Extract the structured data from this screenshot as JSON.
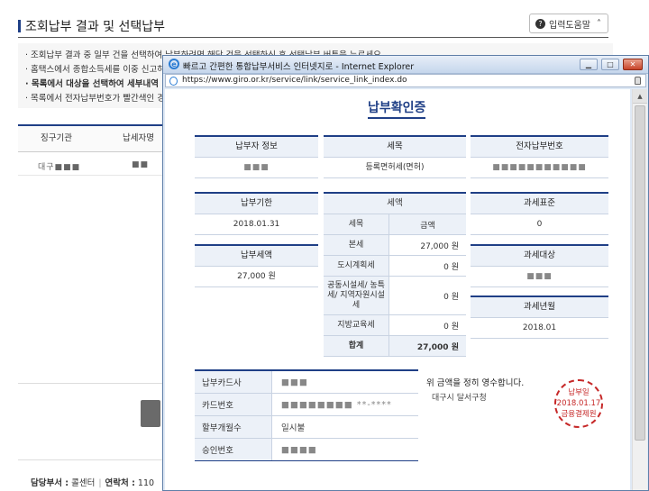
{
  "background": {
    "title": "조회납부 결과 및 선택납부",
    "help_button": "입력도움말",
    "notes": [
      "· 조회납부 결과 중 일부 건을 선택하여 납부하려면 해당 건을 선택하신 후 선택납부 버튼을 누르세요.",
      "· 홈택스에서 종합소득세를 이중 신고하",
      "· 목록에서 대상을 선택하여 세부내역",
      "· 목록에서 전자납부번호가 빨간색인 경"
    ],
    "table_headers": [
      "징구기관",
      "납세자명"
    ],
    "row_values": [
      "대구■■■",
      "■■"
    ],
    "footer": {
      "dept_label": "담당부서 :",
      "dept_value": "콜센터",
      "contact_label": "연락처 :",
      "contact_value": "110"
    }
  },
  "popup": {
    "window_title": "빠르고 간편한 통합납부서비스 인터넷지로 - Internet Explorer",
    "url": "https://www.giro.or.kr/service/link/service_link_index.do",
    "receipt": {
      "title": "납부확인증",
      "payer_info_label": "납부자 정보",
      "payer_info_value": "■■■",
      "tax_item_label": "세목",
      "tax_item_value": "등록면허세(면허)",
      "epay_no_label": "전자납부번호",
      "epay_no_value": "■■■■■■■■■■■",
      "due_date_label": "납부기한",
      "due_date_value": "2018.01.31",
      "tax_base_label": "과세표준",
      "tax_base_value": "0",
      "pay_amount_label": "납부세액",
      "pay_amount_value": "27,000 원",
      "tax_target_label": "과세대상",
      "tax_target_value": "■■■",
      "tax_year_label": "과세년월",
      "tax_year_value": "2018.01",
      "tax_amount_header": "세액",
      "tax_table_headers": [
        "세목",
        "금액"
      ],
      "tax_rows": [
        {
          "name": "본세",
          "amount": "27,000 원"
        },
        {
          "name": "도시계획세",
          "amount": "0 원"
        },
        {
          "name": "공동시설세/ 농특세/ 지역자원시설세",
          "amount": "0 원"
        },
        {
          "name": "지방교육세",
          "amount": "0 원"
        }
      ],
      "tax_total_label": "합계",
      "tax_total_value": "27,000 원",
      "payment_rows": [
        {
          "label": "납부카드사",
          "value": "■■■"
        },
        {
          "label": "카드번호",
          "value": "■■■■■■■■ **-****"
        },
        {
          "label": "할부개월수",
          "value": "일시불"
        },
        {
          "label": "승인번호",
          "value": "■■■■"
        }
      ],
      "receipt_message": "위 금액을 정히 영수합니다.",
      "receipt_org": "대구시 달서구청",
      "stamp_top": "납부일",
      "stamp_date": "2018.01.17",
      "stamp_bottom": "금융결제원"
    }
  },
  "colors": {
    "accent": "#1f3f86",
    "stamp": "#c62828"
  }
}
